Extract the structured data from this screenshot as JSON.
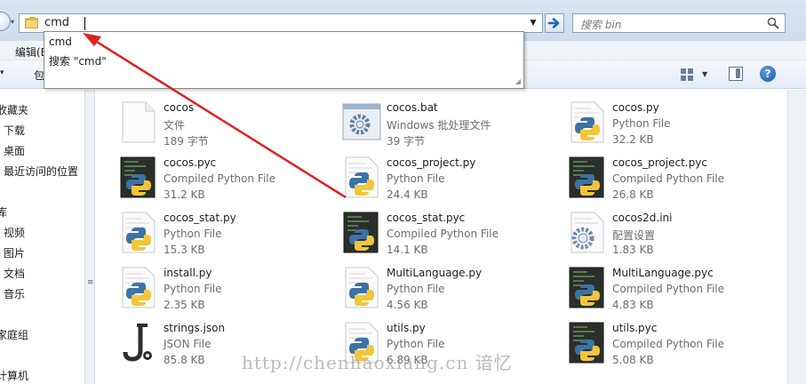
{
  "address_bar": {
    "value": "cmd",
    "search_placeholder": "搜索 bin"
  },
  "autocomplete": {
    "items": [
      "cmd",
      "搜索 \"cmd\""
    ]
  },
  "menu": {
    "edit_label": "编辑(E)",
    "toolbar_partial": "包"
  },
  "nav_pane": {
    "items": [
      "收藏夹",
      "下载",
      "桌面",
      "最近访问的位置",
      "库",
      "视频",
      "图片",
      "文档",
      "音乐",
      "家庭组",
      "计算机"
    ]
  },
  "files": [
    {
      "name": "cocos",
      "type": "文件",
      "size": "189 字节",
      "icon": "blank-file-icon"
    },
    {
      "name": "cocos.bat",
      "type": "Windows 批处理文件",
      "size": "39 字节",
      "icon": "batch-file-icon"
    },
    {
      "name": "cocos.py",
      "type": "Python File",
      "size": "32.2 KB",
      "icon": "python-file-icon"
    },
    {
      "name": "cocos.pyc",
      "type": "Compiled Python File",
      "size": "31.2 KB",
      "icon": "compiled-python-icon"
    },
    {
      "name": "cocos_project.py",
      "type": "Python File",
      "size": "24.4 KB",
      "icon": "python-file-icon"
    },
    {
      "name": "cocos_project.pyc",
      "type": "Compiled Python File",
      "size": "26.8 KB",
      "icon": "compiled-python-icon"
    },
    {
      "name": "cocos_stat.py",
      "type": "Python File",
      "size": "15.3 KB",
      "icon": "python-file-icon"
    },
    {
      "name": "cocos_stat.pyc",
      "type": "Compiled Python File",
      "size": "14.1 KB",
      "icon": "compiled-python-icon"
    },
    {
      "name": "cocos2d.ini",
      "type": "配置设置",
      "size": "1.83 KB",
      "icon": "config-file-icon"
    },
    {
      "name": "install.py",
      "type": "Python File",
      "size": "2.35 KB",
      "icon": "python-file-icon"
    },
    {
      "name": "MultiLanguage.py",
      "type": "Python File",
      "size": "4.56 KB",
      "icon": "python-file-icon"
    },
    {
      "name": "MultiLanguage.pyc",
      "type": "Compiled Python File",
      "size": "4.83 KB",
      "icon": "compiled-python-icon"
    },
    {
      "name": "strings.json",
      "type": "JSON File",
      "size": "85.8 KB",
      "icon": "json-file-icon"
    },
    {
      "name": "utils.py",
      "type": "Python File",
      "size": "6.89 KB",
      "icon": "python-file-icon"
    },
    {
      "name": "utils.pyc",
      "type": "Compiled Python File",
      "size": "5.08 KB",
      "icon": "compiled-python-icon"
    }
  ],
  "watermark": "http://chenhaoxiang.cn 谙忆",
  "colors": {
    "annotation_arrow": "#e02020",
    "python_blue": "#3b73a6",
    "python_yellow": "#f2c63a"
  }
}
